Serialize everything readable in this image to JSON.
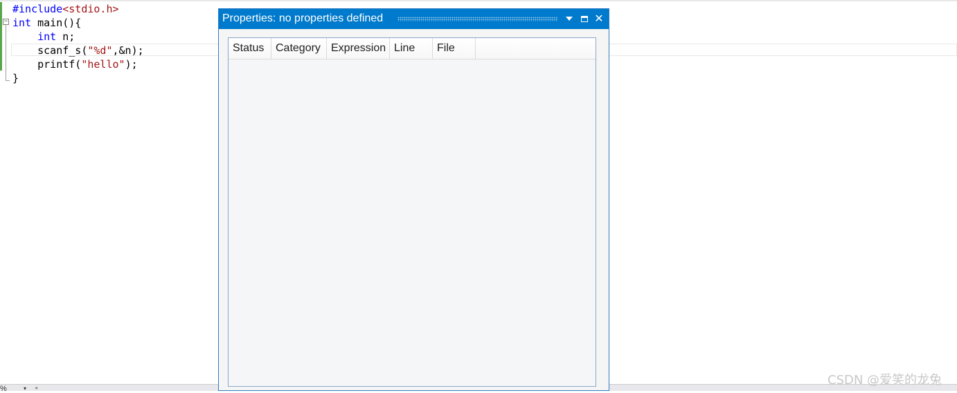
{
  "editor": {
    "lines": [
      {
        "parts": [
          {
            "t": "#include",
            "c": "pp"
          },
          {
            "t": "<stdio.h>",
            "c": "inc"
          }
        ]
      },
      {
        "parts": [
          {
            "t": "int",
            "c": "kw"
          },
          {
            "t": " main(){",
            "c": ""
          }
        ]
      },
      {
        "parts": [
          {
            "t": "    ",
            "c": ""
          },
          {
            "t": "int",
            "c": "kw"
          },
          {
            "t": " n;",
            "c": ""
          }
        ]
      },
      {
        "parts": [
          {
            "t": "    scanf_s(",
            "c": ""
          },
          {
            "t": "\"%d\"",
            "c": "str"
          },
          {
            "t": ",&n);",
            "c": ""
          }
        ]
      },
      {
        "parts": [
          {
            "t": "    printf(",
            "c": ""
          },
          {
            "t": "\"hello\"",
            "c": "str"
          },
          {
            "t": ");",
            "c": ""
          }
        ]
      },
      {
        "parts": [
          {
            "t": "}",
            "c": ""
          }
        ]
      }
    ],
    "fold_glyph": "−",
    "zoom": "%",
    "zoom_arrow": "▾",
    "scroll_left_glyph": "◂"
  },
  "panel": {
    "title": "Properties: no properties defined",
    "dropdown_icon": "dropdown-arrow",
    "maximize_icon": "maximize-square",
    "close_glyph": "✕",
    "columns": [
      {
        "label": "Status",
        "key": "status"
      },
      {
        "label": "Category",
        "key": "category"
      },
      {
        "label": "Expression",
        "key": "expression"
      },
      {
        "label": "Line",
        "key": "line"
      },
      {
        "label": "File",
        "key": "file"
      }
    ],
    "rows": []
  },
  "watermark": "CSDN @爱笑的龙兔",
  "colors": {
    "accent": "#007acc",
    "keyword": "#0000ff",
    "string": "#a31515",
    "change_bar": "#57a64a"
  }
}
